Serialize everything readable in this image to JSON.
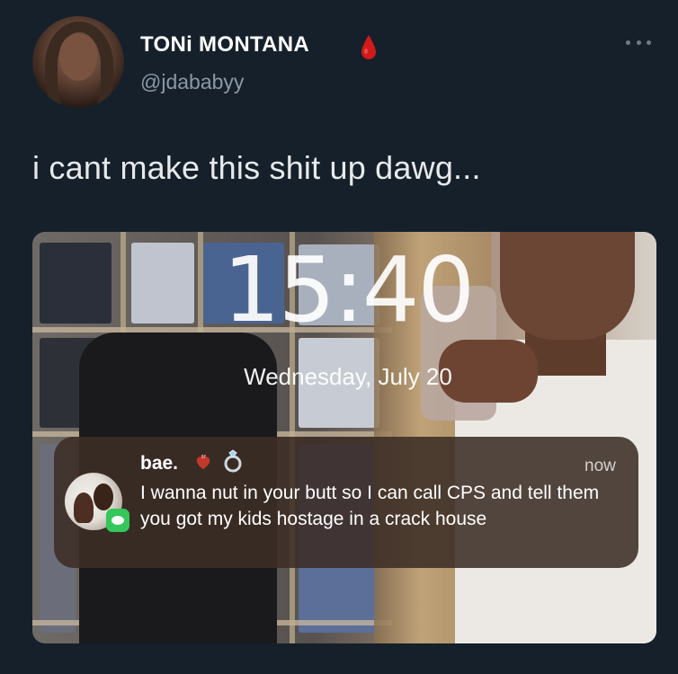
{
  "author": {
    "display_name": "TONi MONTANA",
    "handle": "@jdababyy",
    "name_emoji_icon": "blood-drop-icon"
  },
  "menu": {
    "more_icon": "ellipsis-icon"
  },
  "tweet": {
    "text": "i cant make this shit up dawg..."
  },
  "lockscreen": {
    "time": "15:40",
    "date": "Wednesday, July 20",
    "notification": {
      "sender": "bae.",
      "sender_emoji_icons": [
        "anatomical-heart-icon",
        "ring-icon"
      ],
      "timestamp": "now",
      "app_icon": "messages-icon",
      "message": "I wanna nut in your butt so I can call CPS and tell them you got my kids hostage in a crack house"
    }
  },
  "colors": {
    "background": "#15202b",
    "handle": "#8b98a5",
    "messages_green": "#34c759"
  }
}
